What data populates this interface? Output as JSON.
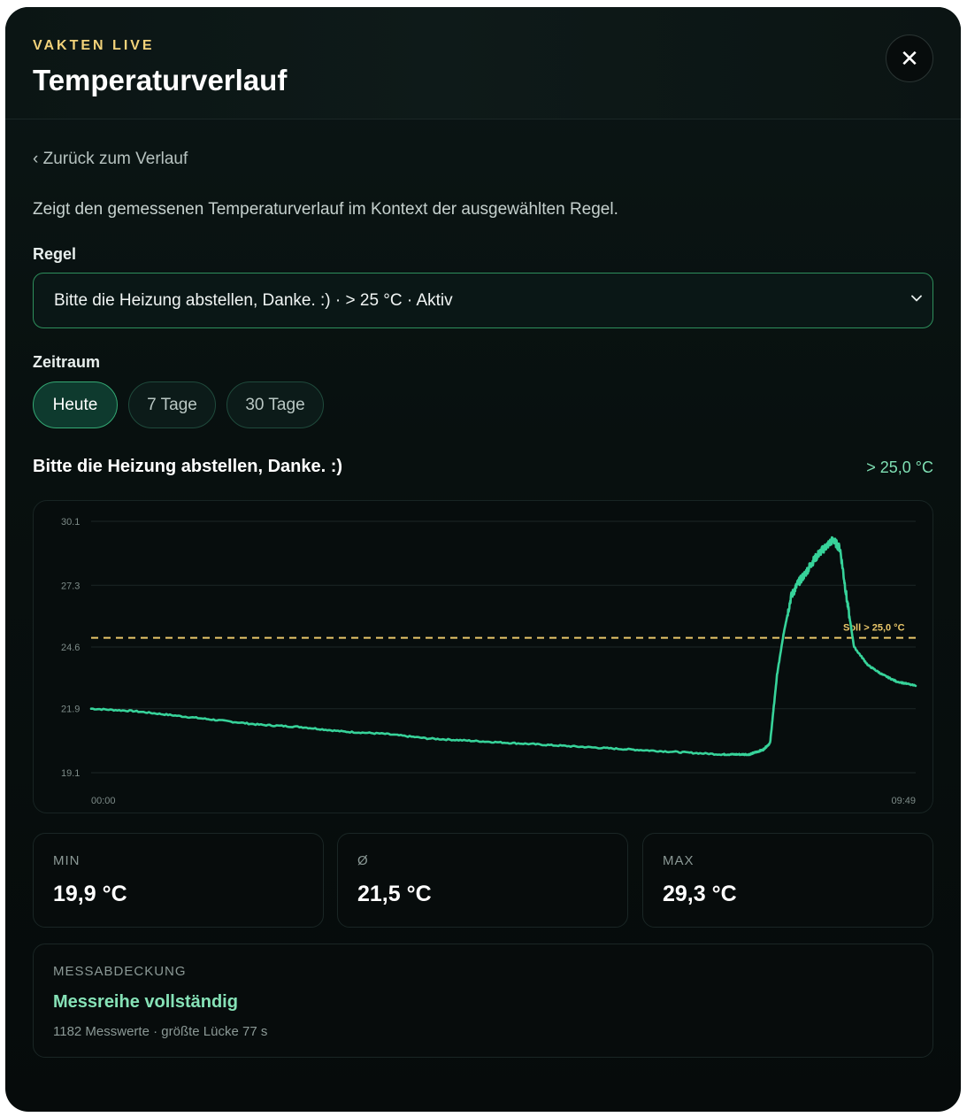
{
  "header": {
    "eyebrow": "VAKTEN LIVE",
    "title": "Temperaturverlauf",
    "close_icon": "close-icon"
  },
  "back_link": "‹ Zurück zum Verlauf",
  "description": "Zeigt den gemessenen Temperaturverlauf im Kontext der ausgewählten Regel.",
  "rule": {
    "label": "Regel",
    "selected": "Bitte die Heizung abstellen, Danke. :) · > 25 °C · Aktiv",
    "icon": "chevron-down-icon"
  },
  "period": {
    "label": "Zeitraum",
    "options": [
      "Heute",
      "7 Tage",
      "30 Tage"
    ],
    "active": "Heute"
  },
  "chart": {
    "title": "Bitte die Heizung abstellen, Danke. :)",
    "threshold_label": "> 25,0 °C",
    "threshold_marker": "Soll > 25,0 °C"
  },
  "chart_data": {
    "type": "line",
    "series": [
      {
        "x": [
          "00:00",
          "00:30",
          "01:00",
          "01:30",
          "02:00",
          "02:30",
          "03:00",
          "03:30",
          "04:00",
          "04:30",
          "05:00",
          "05:30",
          "06:00",
          "06:30",
          "07:00",
          "07:30",
          "07:40",
          "07:50",
          "07:55",
          "08:00",
          "08:05",
          "08:10",
          "08:15",
          "08:20",
          "08:25",
          "08:30",
          "08:35",
          "08:40",
          "08:45",
          "08:50",
          "08:55",
          "09:00",
          "09:05",
          "09:15",
          "09:25",
          "09:35",
          "09:49"
        ],
        "values": [
          21.9,
          21.8,
          21.6,
          21.4,
          21.2,
          21.1,
          20.9,
          20.8,
          20.6,
          20.5,
          20.4,
          20.3,
          20.2,
          20.1,
          20.0,
          19.9,
          19.9,
          19.9,
          20.0,
          20.1,
          20.4,
          23.4,
          25.3,
          26.8,
          27.4,
          27.8,
          28.3,
          28.7,
          29.0,
          29.3,
          28.9,
          26.6,
          24.6,
          23.8,
          23.4,
          23.1,
          22.9
        ]
      }
    ],
    "threshold": 25.0,
    "ylim": [
      19.1,
      30.1
    ],
    "yticks": [
      "30.1",
      "27.3",
      "24.6",
      "21.9",
      "19.1"
    ],
    "xticks": [
      "00:00",
      "09:49"
    ],
    "grid": true,
    "colors": {
      "line": "#37d39a",
      "threshold": "#e9c76a",
      "grid": "#1c2726"
    }
  },
  "stats": [
    {
      "label": "MIN",
      "value": "19,9 °C"
    },
    {
      "label": "Ø",
      "value": "21,5 °C"
    },
    {
      "label": "MAX",
      "value": "29,3 °C"
    }
  ],
  "coverage": {
    "label": "MESSABDECKUNG",
    "status": "Messreihe vollständig",
    "detail": "1182 Messwerte · größte Lücke 77 s"
  }
}
